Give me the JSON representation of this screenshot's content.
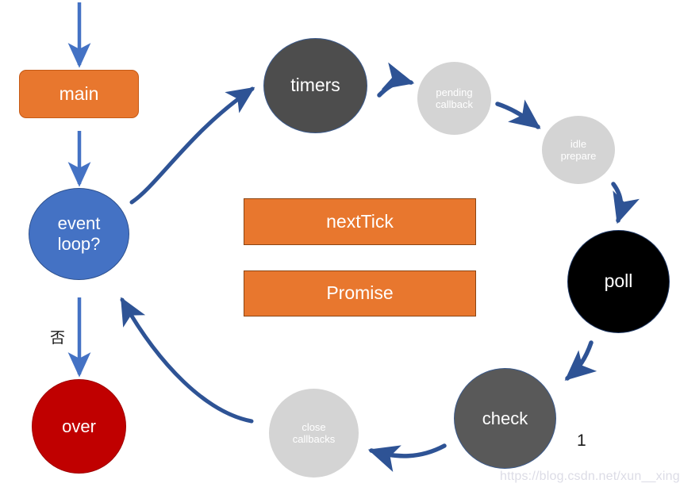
{
  "diagram": {
    "title": "Node.js event loop phases diagram",
    "colors": {
      "orange": "#E8772E",
      "blue": "#4472C4",
      "dark_red": "#C00000",
      "dark_gray": "#4D4D4D",
      "mid_gray": "#595959",
      "light_gray": "#D4D4D4",
      "black": "#000000",
      "arrow_blue": "#2E5395",
      "arrow_light_blue": "#4472C4"
    },
    "nodes": [
      {
        "id": "main",
        "label": "main",
        "shape": "rounded-rect",
        "fill": "#E8772E"
      },
      {
        "id": "event-loop",
        "label": "event\nloop?",
        "shape": "circle",
        "fill": "#4472C4"
      },
      {
        "id": "over",
        "label": "over",
        "shape": "circle",
        "fill": "#C00000"
      },
      {
        "id": "timers",
        "label": "timers",
        "shape": "circle",
        "fill": "#4D4D4D"
      },
      {
        "id": "pending-callback",
        "label": "pending\ncallback",
        "shape": "circle",
        "fill": "#D4D4D4"
      },
      {
        "id": "idle-prepare",
        "label": "idle\nprepare",
        "shape": "circle",
        "fill": "#D4D4D4"
      },
      {
        "id": "poll",
        "label": "poll",
        "shape": "circle",
        "fill": "#000000"
      },
      {
        "id": "check",
        "label": "check",
        "shape": "circle",
        "fill": "#595959"
      },
      {
        "id": "close-callbacks",
        "label": "close\ncallbacks",
        "shape": "circle",
        "fill": "#D4D4D4"
      },
      {
        "id": "next-tick",
        "label": "nextTick",
        "shape": "rect",
        "fill": "#E8772E"
      },
      {
        "id": "promise",
        "label": "Promise",
        "shape": "rect",
        "fill": "#E8772E"
      }
    ],
    "edge_labels": {
      "no": "否",
      "one": "1"
    },
    "watermark": "https://blog.csdn.net/xun__xing"
  }
}
